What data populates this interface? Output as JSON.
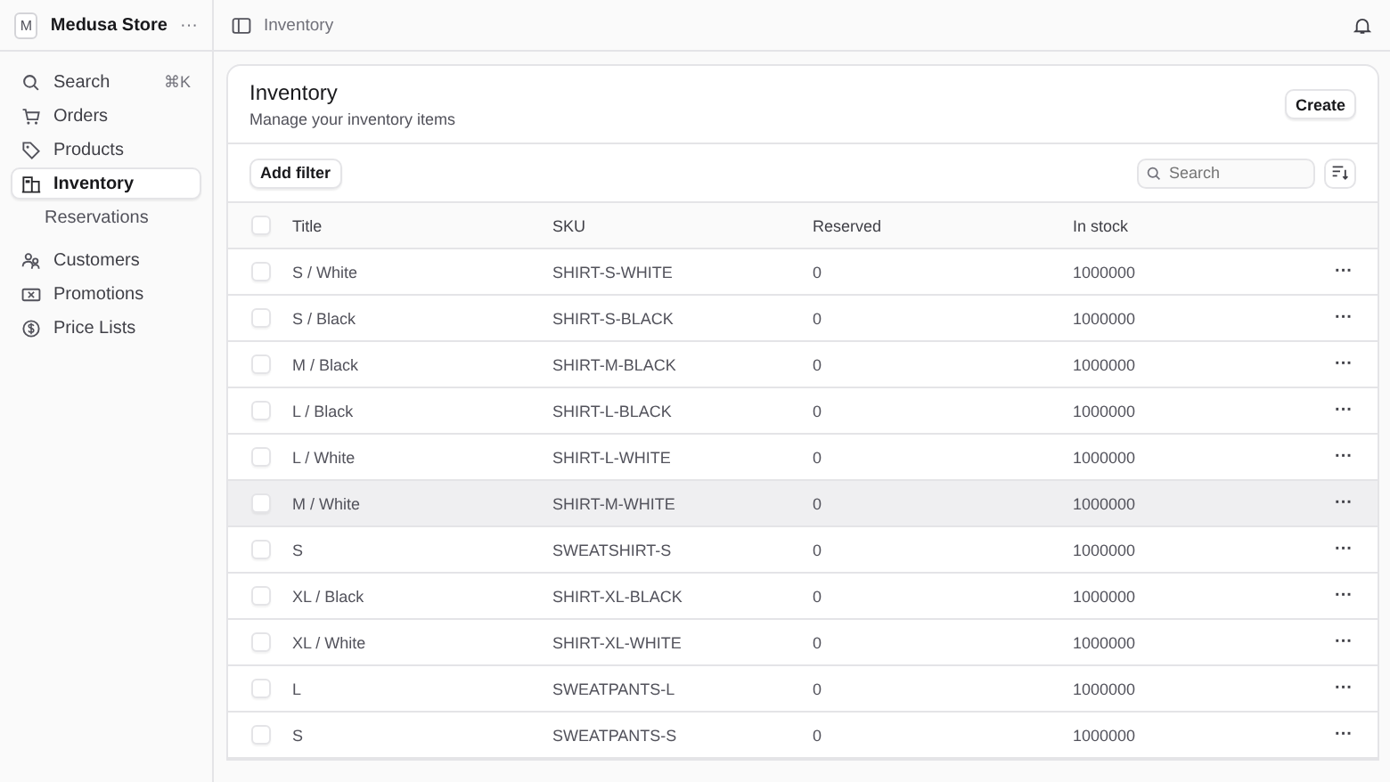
{
  "store": {
    "initial": "M",
    "name": "Medusa Store",
    "menu": "···"
  },
  "sidebar": {
    "items": [
      {
        "kind": "search",
        "label": "Search",
        "shortcut": "⌘K",
        "selected": false
      },
      {
        "kind": "orders",
        "label": "Orders",
        "selected": false
      },
      {
        "kind": "products",
        "label": "Products",
        "selected": false
      },
      {
        "kind": "inventory",
        "label": "Inventory",
        "selected": true
      },
      {
        "kind": "sub",
        "label": "Reservations",
        "selected": false
      },
      {
        "kind": "gap"
      },
      {
        "kind": "customers",
        "label": "Customers",
        "selected": false
      },
      {
        "kind": "promotions",
        "label": "Promotions",
        "selected": false
      },
      {
        "kind": "prices",
        "label": "Price Lists",
        "selected": false
      }
    ]
  },
  "topbar": {
    "breadcrumb": "Inventory"
  },
  "page": {
    "title": "Inventory",
    "subtitle": "Manage your inventory items",
    "create": "Create",
    "add_filter": "Add filter",
    "search": {
      "placeholder": "Search"
    }
  },
  "table": {
    "select_all": {
      "checked": false
    },
    "columns": [
      "Title",
      "SKU",
      "Reserved",
      "In stock"
    ],
    "rows": [
      {
        "title": "S / White",
        "sku": "SHIRT-S-WHITE",
        "reserved": "0",
        "stock": "1000000",
        "hovered": false,
        "menu": "···"
      },
      {
        "title": "S / Black",
        "sku": "SHIRT-S-BLACK",
        "reserved": "0",
        "stock": "1000000",
        "hovered": false,
        "menu": "···"
      },
      {
        "title": "M / Black",
        "sku": "SHIRT-M-BLACK",
        "reserved": "0",
        "stock": "1000000",
        "hovered": false,
        "menu": "···"
      },
      {
        "title": "L / Black",
        "sku": "SHIRT-L-BLACK",
        "reserved": "0",
        "stock": "1000000",
        "hovered": false,
        "menu": "···"
      },
      {
        "title": "L / White",
        "sku": "SHIRT-L-WHITE",
        "reserved": "0",
        "stock": "1000000",
        "hovered": false,
        "menu": "···"
      },
      {
        "title": "M / White",
        "sku": "SHIRT-M-WHITE",
        "reserved": "0",
        "stock": "1000000",
        "hovered": true,
        "menu": "···"
      },
      {
        "title": "S",
        "sku": "SWEATSHIRT-S",
        "reserved": "0",
        "stock": "1000000",
        "hovered": false,
        "menu": "···"
      },
      {
        "title": "XL / Black",
        "sku": "SHIRT-XL-BLACK",
        "reserved": "0",
        "stock": "1000000",
        "hovered": false,
        "menu": "···"
      },
      {
        "title": "XL / White",
        "sku": "SHIRT-XL-WHITE",
        "reserved": "0",
        "stock": "1000000",
        "hovered": false,
        "menu": "···"
      },
      {
        "title": "L",
        "sku": "SWEATPANTS-L",
        "reserved": "0",
        "stock": "1000000",
        "hovered": false,
        "menu": "···"
      },
      {
        "title": "S",
        "sku": "SWEATPANTS-S",
        "reserved": "0",
        "stock": "1000000",
        "hovered": false,
        "menu": "···"
      }
    ]
  }
}
